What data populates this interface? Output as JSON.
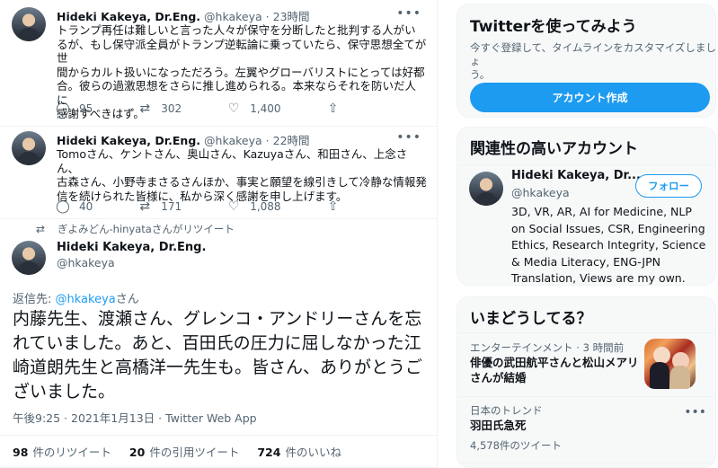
{
  "tweets": [
    {
      "name": "Hideki Kakeya, Dr.Eng.",
      "handle": "@hkakeya",
      "separator": "·",
      "time": "23時間",
      "more": "•••",
      "lines": [
        "トランプ再任は難しいと言った人々が保守を分断したと批判する人がいるが、もし保守派全員がトランプ逆転論に乗っていたら、保守思想全てが世",
        "間からカルト扱いになっただろう。左翼やグローバリストにとっては好都",
        "合。彼らの過激思想をさらに推し進められる。本来ならそれを防いだ人に",
        "感謝すべきはず。"
      ],
      "actions": {
        "reply": "95",
        "retweet": "302",
        "like": "1,400"
      }
    },
    {
      "name": "Hideki Kakeya, Dr.Eng.",
      "handle": "@hkakeya",
      "separator": "·",
      "time": "22時間",
      "more": "•••",
      "lines": [
        "Tomoさん、ケントさん、奥山さん、Kazuyaさん、和田さん、上念さん、",
        "古森さん、小野寺まさるさんほか、事実と願望を線引きして冷静な情報発",
        "信を続けられた皆様に、私から深く感謝を申し上げます。"
      ],
      "actions": {
        "reply": "40",
        "retweet": "171",
        "like": "1,088"
      }
    }
  ],
  "retweet_note": "ぎよみどん-hinyataさんがリツイート",
  "main_tweet": {
    "name": "Hideki Kakeya, Dr.Eng.",
    "handle": "@hkakeya",
    "reply_prefix": "返信先: ",
    "reply_mention": "@hkakeya",
    "reply_suffix": "さん",
    "lines": [
      "内藤先生、渡瀬さん、グレンコ・アンドリーさんを忘",
      "れていました。あと、百田氏の圧力に屈しなかった江",
      "崎道朗先生と高橋洋一先生も。皆さん、ありがとうご",
      "ざいました。"
    ],
    "meta": "午後9:25 · 2021年1月13日 · Twitter Web App",
    "counts": [
      {
        "number": "98",
        "label": "件のリツイート"
      },
      {
        "number": "20",
        "label": "件の引用ツイート"
      },
      {
        "number": "724",
        "label": "件のいいね"
      }
    ]
  },
  "signup": {
    "title": "Twitterを使ってみよう",
    "text_lines": [
      "今すぐ登録して、タイムラインをカスタマイズしましょ",
      "う。"
    ],
    "button": "アカウント作成"
  },
  "relevant": {
    "title": "関連性の高いアカウント",
    "name": "Hideki Kakeya, Dr...",
    "handle": "@hkakeya",
    "follow": "フォロー",
    "bio_lines": [
      "3D, VR, AR, AI for Medicine, NLP",
      "on Social Issues, CSR, Engineering",
      "Ethics, Research Integrity, Science",
      "& Media Literacy, ENG-JPN",
      "Translation, Views are my own."
    ]
  },
  "trends": {
    "title": "いまどうしてる？",
    "items": [
      {
        "category": "エンターテインメント · 3 時間前",
        "title_lines": [
          "俳優の武田航平さんと松山メアリ",
          "さんが結婚"
        ],
        "count": ""
      },
      {
        "category": "日本のトレンド",
        "title_lines": [
          "羽田氏急死"
        ],
        "count": "4,578件のツイート"
      }
    ],
    "more": "•••"
  },
  "icons": {
    "reply": "reply-icon",
    "retweet": "retweet-icon",
    "like": "heart-icon",
    "share": "share-icon",
    "more": "more-icon"
  }
}
